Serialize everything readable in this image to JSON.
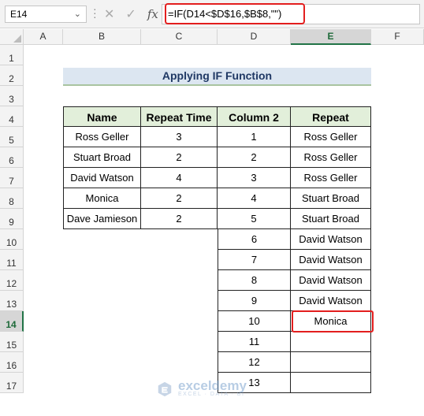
{
  "formula_bar": {
    "name_box": "E14",
    "formula": "=IF(D14<$D$16,$B$8,\"\")"
  },
  "columns": [
    "A",
    "B",
    "C",
    "D",
    "E",
    "F"
  ],
  "rows": [
    "1",
    "2",
    "3",
    "4",
    "5",
    "6",
    "7",
    "8",
    "9",
    "10",
    "11",
    "12",
    "13",
    "14",
    "15",
    "16",
    "17"
  ],
  "active_cell": {
    "column": "E",
    "row": "14"
  },
  "title": "Applying IF Function",
  "table": {
    "headers": [
      "Name",
      "Repeat Time",
      "Column 2",
      "Repeat"
    ],
    "rows": [
      [
        "Ross Geller",
        "3",
        "1",
        "Ross Geller"
      ],
      [
        "Stuart Broad",
        "2",
        "2",
        "Ross Geller"
      ],
      [
        "David Watson",
        "4",
        "3",
        "Ross Geller"
      ],
      [
        "Monica",
        "2",
        "4",
        "Stuart Broad"
      ],
      [
        "Dave Jamieson",
        "2",
        "5",
        "Stuart Broad"
      ],
      [
        "",
        "",
        "6",
        "David Watson"
      ],
      [
        "",
        "",
        "7",
        "David Watson"
      ],
      [
        "",
        "",
        "8",
        "David Watson"
      ],
      [
        "",
        "",
        "9",
        "David Watson"
      ],
      [
        "",
        "",
        "10",
        "Monica"
      ],
      [
        "",
        "",
        "11",
        ""
      ],
      [
        "",
        "",
        "12",
        ""
      ],
      [
        "",
        "",
        "13",
        ""
      ]
    ]
  },
  "watermark": {
    "brand": "exceldemy",
    "tagline": "EXCEL · DATA · BI"
  },
  "colors": {
    "header_fill": "#e2efda",
    "title_fill": "#dce6f1",
    "highlight": "#e31e1e",
    "excel_green": "#217346"
  }
}
